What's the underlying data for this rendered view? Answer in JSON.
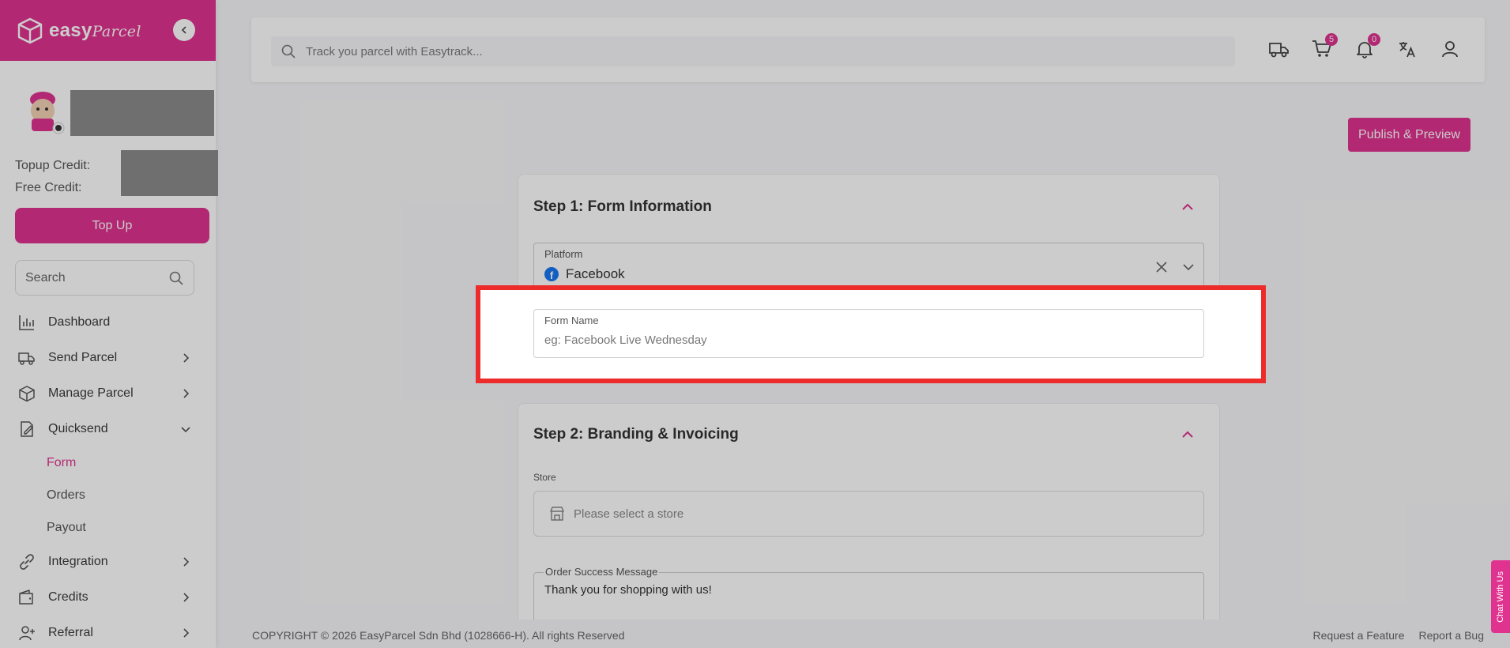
{
  "brand": {
    "name_main": "easy",
    "name_script": "Parcel",
    "color": "#e0328f"
  },
  "sidebar": {
    "topup_credit_label": "Topup Credit:",
    "free_credit_label": "Free Credit:",
    "topup_button": "Top Up",
    "search_placeholder": "Search",
    "items": [
      {
        "label": "Dashboard",
        "icon": "chart-bar-icon"
      },
      {
        "label": "Send Parcel",
        "icon": "truck-icon"
      },
      {
        "label": "Manage Parcel",
        "icon": "box-icon"
      },
      {
        "label": "Quicksend",
        "icon": "edit-icon"
      },
      {
        "label": "Integration",
        "icon": "link-icon"
      },
      {
        "label": "Credits",
        "icon": "wallet-icon"
      },
      {
        "label": "Referral",
        "icon": "user-plus-icon"
      }
    ],
    "sub_items": [
      {
        "label": "Form"
      },
      {
        "label": "Orders"
      },
      {
        "label": "Payout"
      }
    ]
  },
  "header": {
    "track_placeholder": "Track you parcel with Easytrack...",
    "cart_count": "5",
    "notification_count": "0"
  },
  "actions": {
    "publish": "Publish & Preview"
  },
  "step1": {
    "title": "Step 1: Form Information",
    "platform_label": "Platform",
    "platform_value": "Facebook",
    "form_name_label": "Form Name",
    "form_name_placeholder": "eg: Facebook Live Wednesday"
  },
  "step2": {
    "title": "Step 2: Branding & Invoicing",
    "store_label": "Store",
    "store_placeholder": "Please select a store",
    "success_label": "Order Success Message",
    "success_value": "Thank you for shopping with us!"
  },
  "footer": {
    "copyright": "COPYRIGHT © 2026 EasyParcel Sdn Bhd (1028666-H). All rights Reserved",
    "request_feature": "Request a Feature",
    "report_bug": "Report a Bug"
  },
  "chat": {
    "label": "Chat With Us"
  }
}
